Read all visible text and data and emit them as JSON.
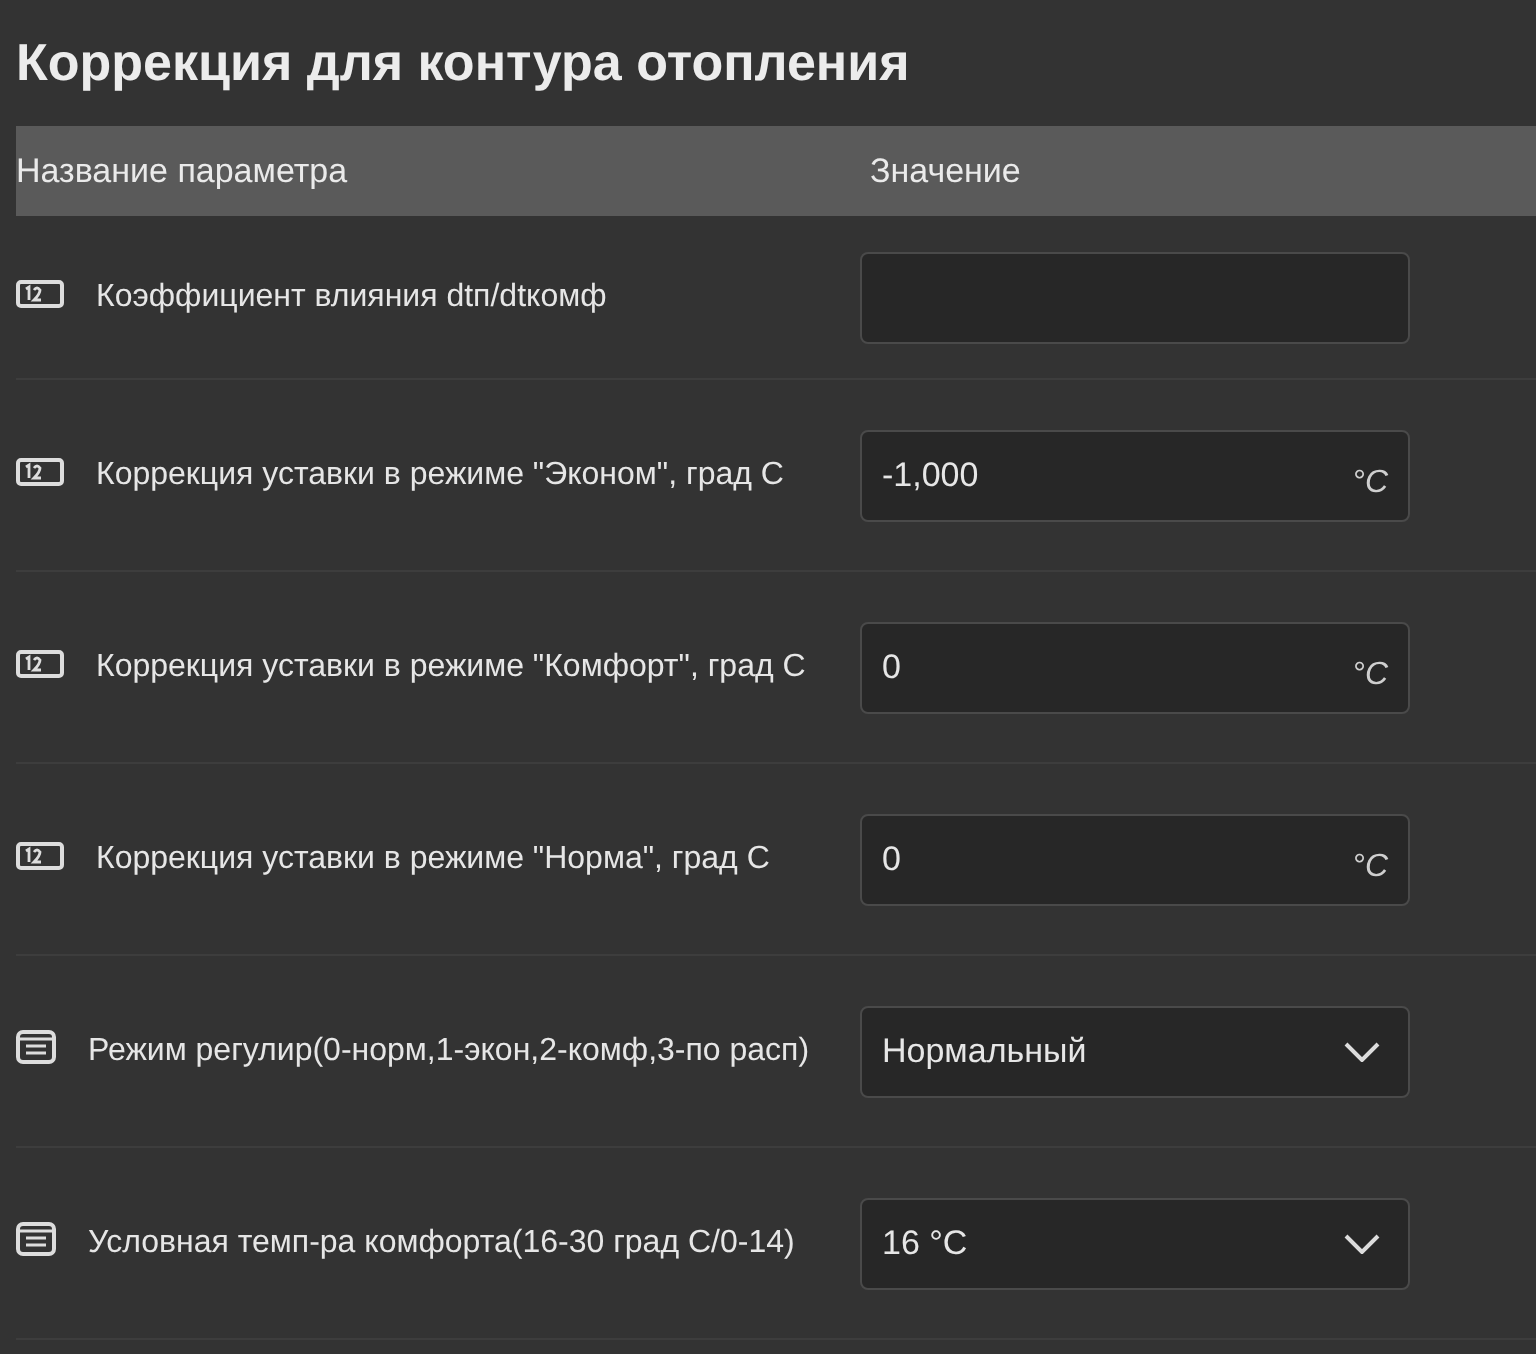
{
  "title": "Коррекция для контура отопления",
  "columns": [
    "Название параметра",
    "Значение"
  ],
  "rows": [
    {
      "kind": "number",
      "label": "Коэффициент влияния dtп/dtкомф"
    },
    {
      "kind": "number",
      "label": "Коррекция уставки в режиме \"Эконом\", град С",
      "value": "-1,000",
      "unit": "°C"
    },
    {
      "kind": "number",
      "label": "Коррекция уставки в режиме \"Комфорт\", град С",
      "value": "0",
      "unit": "°C"
    },
    {
      "kind": "number",
      "label": "Коррекция уставки в режиме \"Норма\", град С",
      "value": "0",
      "unit": "°C"
    },
    {
      "kind": "select",
      "label": "Режим регулир(0-норм,1-экон,2-комф,3-по расп)",
      "value": "Нормальный"
    },
    {
      "kind": "select",
      "label": "Условная темп-ра комфорта(16-30 град С/0-14)",
      "value": "16 °C"
    }
  ]
}
